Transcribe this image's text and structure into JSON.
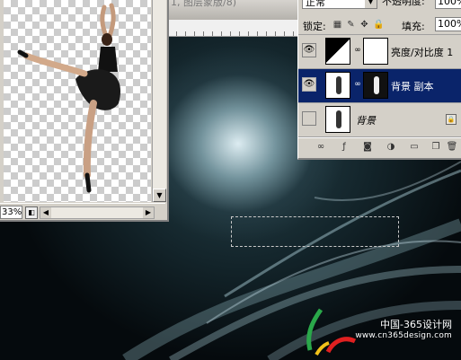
{
  "document": {
    "title_fragment": "1, 图层蒙版/8)"
  },
  "layer_window": {
    "zoom": "33%"
  },
  "layers_panel": {
    "blend_mode": "正常",
    "opacity_label": "不透明度:",
    "opacity_value": "100%",
    "lock_label": "锁定:",
    "fill_label": "填充:",
    "fill_value": "100%",
    "layers": [
      {
        "name": "亮度/对比度 1",
        "selected": false,
        "visible": true,
        "type": "adjustment"
      },
      {
        "name": "背景 副本",
        "selected": true,
        "visible": true,
        "type": "masked"
      },
      {
        "name": "背景",
        "selected": false,
        "visible": false,
        "type": "background",
        "locked": true
      }
    ],
    "toolbar_icons": [
      "link-icon",
      "fx-icon",
      "mask-icon",
      "adjustment-icon",
      "folder-icon",
      "new-layer-icon",
      "trash-icon"
    ]
  },
  "watermark": {
    "line1": "中国-365设计网",
    "line2": "www.cn365design.com"
  },
  "colors": {
    "selection_highlight": "#0a246a",
    "panel_bg": "#d4d0c8"
  }
}
